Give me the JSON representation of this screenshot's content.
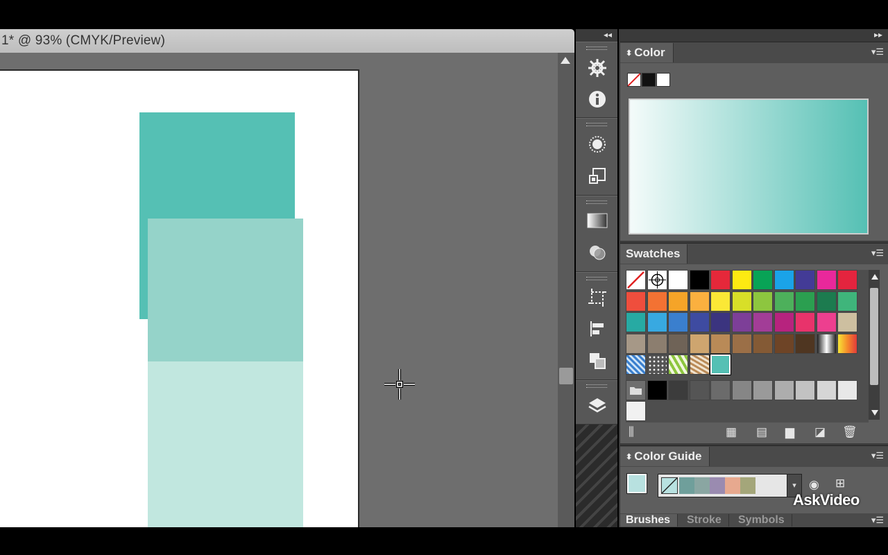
{
  "document": {
    "title": "1* @ 93% (CMYK/Preview)"
  },
  "artwork": {
    "shapes": [
      {
        "name": "teal-square",
        "color": "#55c0b4"
      },
      {
        "name": "mint-square",
        "color": "#95d3c9"
      },
      {
        "name": "pale-square",
        "color": "#c1e7df"
      }
    ]
  },
  "toolstrip": {
    "icons": [
      "navigator-icon",
      "info-icon",
      "appearance-icon",
      "transform-icon",
      "gradient-icon",
      "transparency-icon",
      "artboards-icon",
      "align-icon",
      "pathfinder-icon",
      "layers-icon"
    ]
  },
  "color_panel": {
    "title": "Color",
    "collapse_icon": "chevron-updown-icon",
    "gradient_from": "#f4fbfa",
    "gradient_to": "#55c0b4"
  },
  "swatches_panel": {
    "title": "Swatches",
    "rows": [
      [
        "none",
        "registration",
        "#ffffff",
        "#000000",
        "#e5283a",
        "#fdea12",
        "#08a356",
        "#1aa3e8",
        "#433b96",
        "#e9289b",
        "#e4243e"
      ],
      [
        "#ef4e3d",
        "#f37233",
        "#f5a428",
        "#fbb03f",
        "#fbe836",
        "#d8df28",
        "#8dc63f",
        "#4db05b",
        "#2b9f50",
        "#1c7b4f",
        "#3fb57b"
      ],
      [
        "#27aaa3",
        "#38a9e1",
        "#3a7fce",
        "#3e4ba1",
        "#3b347f",
        "#7d3f98",
        "#a23d97",
        "#b7237e",
        "#e8336b",
        "#ed3f8f",
        "#cdbfa0"
      ],
      [
        "#a69887",
        "#8c7e6f",
        "#6f6357",
        "#cea56f",
        "#b98a57",
        "#9b6f47",
        "#845a35",
        "#6e4426",
        "#4f3621",
        "gradient-bw",
        "gradient-orange"
      ],
      [
        "pattern-blue",
        "pattern-dots",
        "pattern-leaves",
        "pattern-brown",
        "selected-teal"
      ],
      [
        "folder",
        "#000000",
        "#3c3c3c",
        "#555555",
        "#6b6b6b",
        "#868686",
        "#9a9a9a",
        "#adadad",
        "#c2c2c2",
        "#d6d6d6",
        "#e8e8e8"
      ],
      [
        "#f1f1f1"
      ]
    ]
  },
  "color_guide_panel": {
    "title": "Color Guide",
    "current_color": "#b8e1e0",
    "harmony": [
      "#6f9f9b",
      "#8aa6a2",
      "#9a8bb0",
      "#e7a98f",
      "#a4a67a"
    ]
  },
  "bottom_tabs": [
    "Brushes",
    "Stroke",
    "Symbols"
  ],
  "watermark": "AskVideo"
}
